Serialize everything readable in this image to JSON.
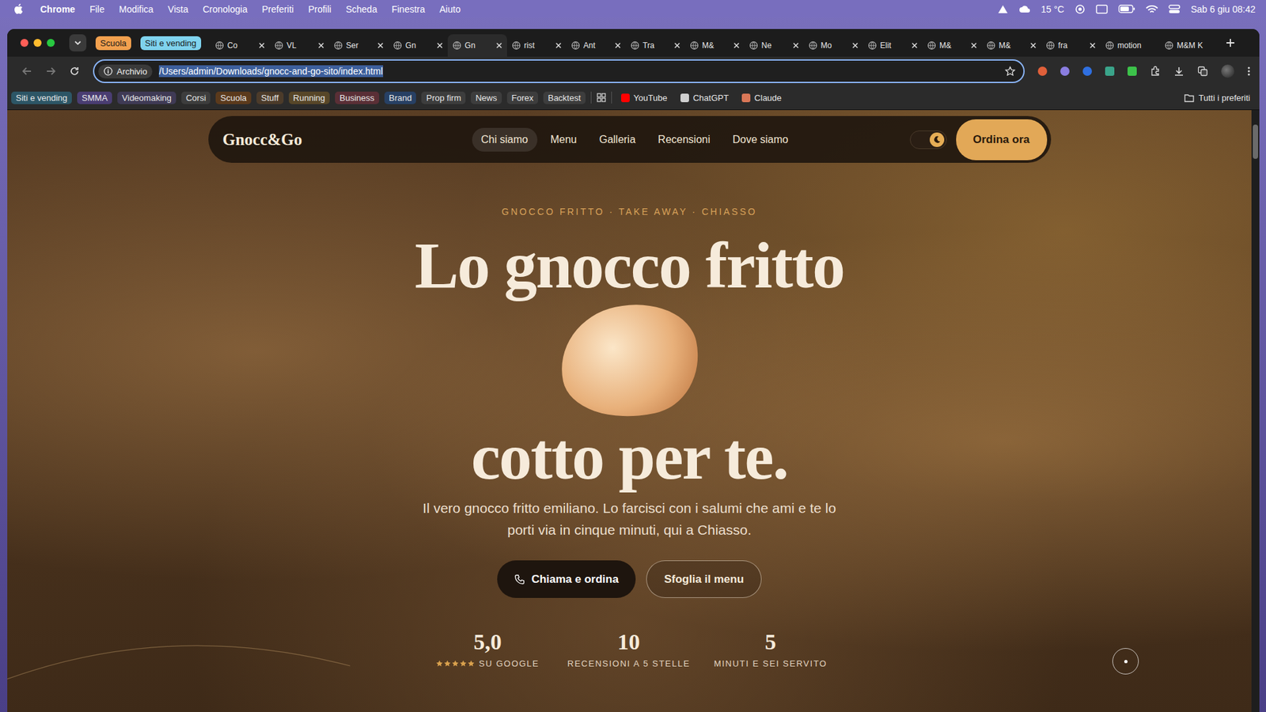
{
  "menubar": {
    "app": "Chrome",
    "items": [
      "File",
      "Modifica",
      "Vista",
      "Cronologia",
      "Preferiti",
      "Profili",
      "Scheda",
      "Finestra",
      "Aiuto"
    ],
    "weather": "15 °C",
    "clock": "Sab 6 giu 08:42"
  },
  "tab_groups": [
    {
      "label": "Scuola",
      "color": "#f2a04e"
    },
    {
      "label": "Siti e vending",
      "color": "#7fd3ee"
    }
  ],
  "tabs": [
    {
      "label": "Co",
      "selected": false,
      "close_button": true
    },
    {
      "label": "VL",
      "selected": false,
      "close_button": true
    },
    {
      "label": "Ser",
      "selected": false,
      "close_button": true
    },
    {
      "label": "Gn",
      "selected": false,
      "close_button": true
    },
    {
      "label": "Gn",
      "selected": true,
      "close_button": true
    },
    {
      "label": "rist",
      "selected": false,
      "close_button": true
    },
    {
      "label": "Ant",
      "selected": false,
      "close_button": true
    },
    {
      "label": "Tra",
      "selected": false,
      "close_button": true
    },
    {
      "label": "M&",
      "selected": false,
      "close_button": true
    },
    {
      "label": "Ne",
      "selected": false,
      "close_button": true
    },
    {
      "label": "Mo",
      "selected": false,
      "close_button": true
    },
    {
      "label": "Elit",
      "selected": false,
      "close_button": true
    },
    {
      "label": "M&",
      "selected": false,
      "close_button": true
    },
    {
      "label": "M&",
      "selected": false,
      "close_button": true
    },
    {
      "label": "fra",
      "selected": false,
      "close_button": true
    },
    {
      "label": "motion",
      "selected": false,
      "close_button": false
    },
    {
      "label": "M&M K",
      "selected": false,
      "close_button": false
    }
  ],
  "address_bar": {
    "chip": "Archivio",
    "url": "/Users/admin/Downloads/gnocc-and-go-sito/index.html",
    "url_selected": true
  },
  "bookmarks": [
    {
      "label": "Siti e vending",
      "kind": "folder",
      "color": "#2d5666"
    },
    {
      "label": "SMMA",
      "kind": "folder",
      "color": "#4a3d72"
    },
    {
      "label": "Videomaking",
      "kind": "folder",
      "color": "#3f3a55"
    },
    {
      "label": "Corsi",
      "kind": "folder",
      "color": "#3d3d3d"
    },
    {
      "label": "Scuola",
      "kind": "folder",
      "color": "#5b3a1c"
    },
    {
      "label": "Stuff",
      "kind": "folder",
      "color": "#4c3b2a"
    },
    {
      "label": "Running",
      "kind": "folder",
      "color": "#574628"
    },
    {
      "label": "Business",
      "kind": "folder",
      "color": "#5a2f36"
    },
    {
      "label": "Brand",
      "kind": "folder",
      "color": "#274064"
    },
    {
      "label": "Prop firm",
      "kind": "folder",
      "color": "#3d3d3d"
    },
    {
      "label": "News",
      "kind": "folder",
      "color": "#3d3d3d"
    },
    {
      "label": "Forex",
      "kind": "folder",
      "color": "#3d3d3d"
    },
    {
      "label": "Backtest",
      "kind": "folder",
      "color": "#3d3d3d"
    },
    {
      "label": "YouTube",
      "kind": "link",
      "color": "#ff0000"
    },
    {
      "label": "ChatGPT",
      "kind": "link",
      "color": "#d0d0d0"
    },
    {
      "label": "Claude",
      "kind": "link",
      "color": "#d97757"
    }
  ],
  "all_bookmarks": "Tutti i preferiti",
  "page": {
    "logo": "Gnocc&Go",
    "nav": [
      {
        "label": "Chi siamo",
        "selected": true
      },
      {
        "label": "Menu",
        "selected": false
      },
      {
        "label": "Galleria",
        "selected": false
      },
      {
        "label": "Recensioni",
        "selected": false
      },
      {
        "label": "Dove siamo",
        "selected": false
      }
    ],
    "theme_toggle": {
      "dark": true
    },
    "cta": "Ordina ora",
    "eyebrow": "GNOCCO FRITTO · TAKE AWAY · CHIASSO",
    "headline": [
      "Lo gnocco fritto",
      "cotto per te."
    ],
    "subtitle": "Il vero gnocco fritto emiliano. Lo farcisci con i salumi che ami e te lo porti via in cinque minuti, qui a Chiasso.",
    "buttons": [
      {
        "label": "Chiama e ordina",
        "kind": "primary"
      },
      {
        "label": "Sfoglia il menu",
        "kind": "secondary"
      }
    ],
    "stats": [
      {
        "value": "5,0",
        "label": "SU GOOGLE",
        "stars": 5
      },
      {
        "value": "10",
        "label": "RECENSIONI A 5 STELLE"
      },
      {
        "value": "5",
        "label": "MINUTI E SEI SERVITO"
      }
    ]
  }
}
